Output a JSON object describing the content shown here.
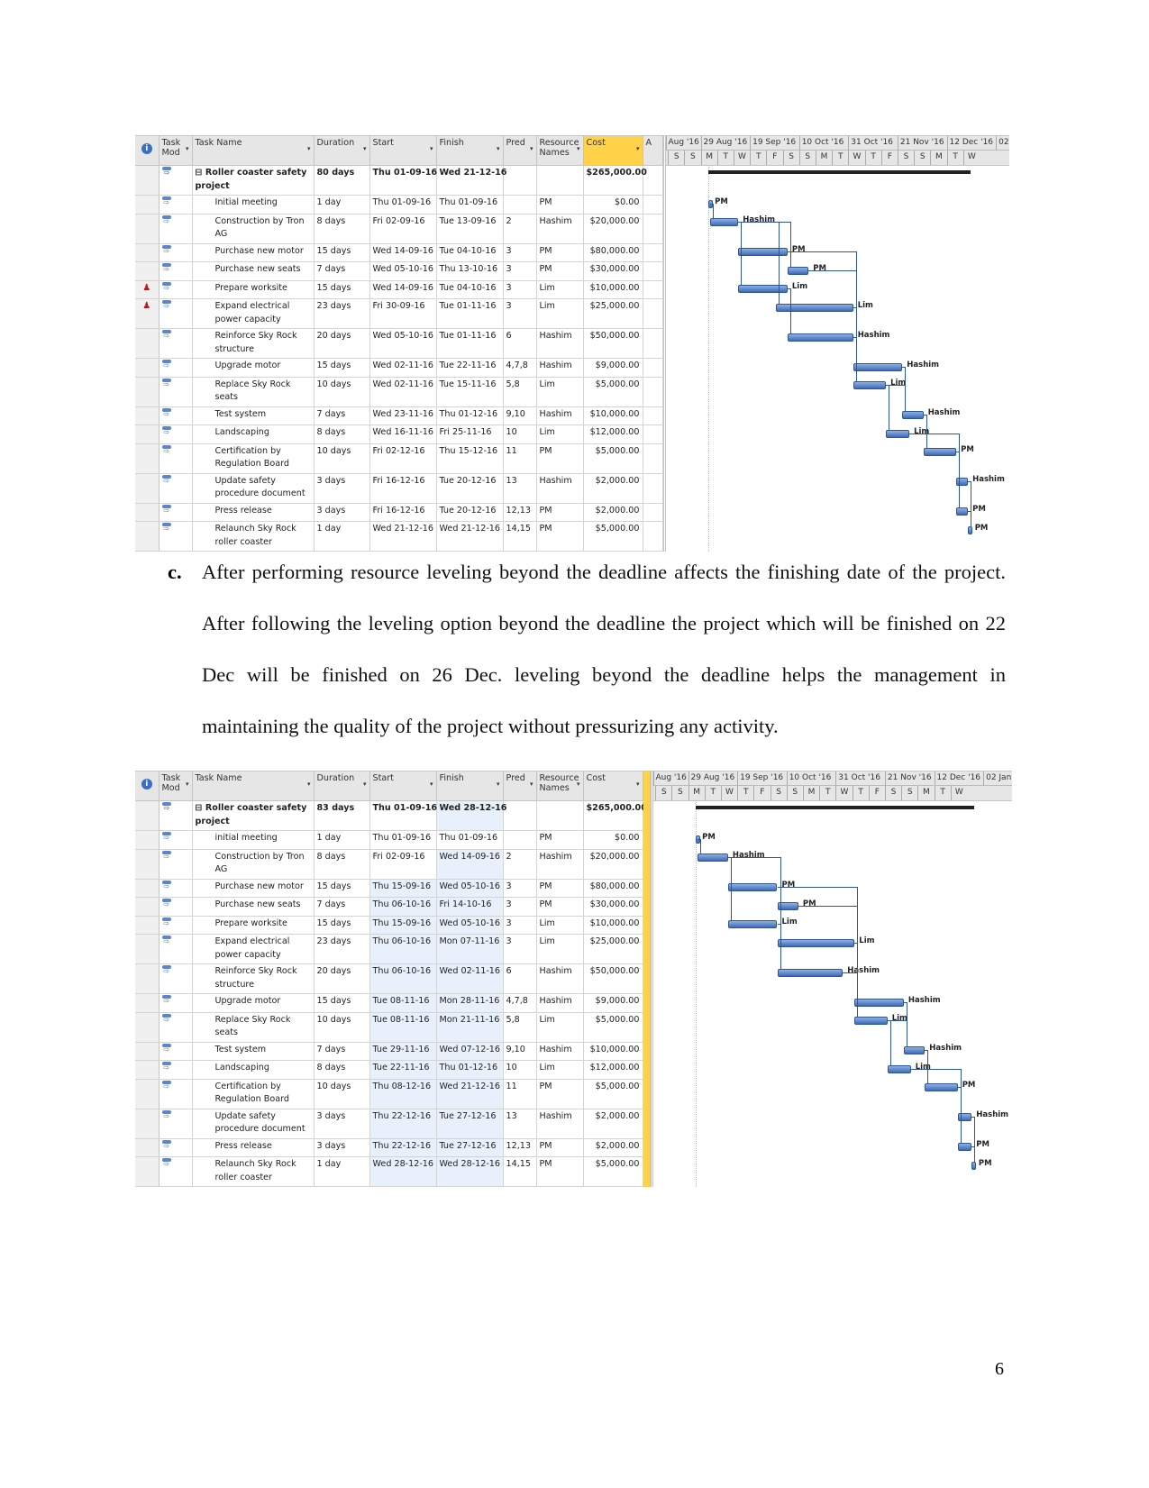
{
  "columns": {
    "indicator": "i",
    "mode": "Task Mod",
    "name": "Task Name",
    "duration": "Duration",
    "start": "Start",
    "finish": "Finish",
    "pred": "Pred",
    "resource": "Resource Names",
    "cost": "Cost",
    "add": "A"
  },
  "before": {
    "timescale": {
      "major": [
        "Aug '16",
        "29 Aug '16",
        "19 Sep '16",
        "10 Oct '16",
        "31 Oct '16",
        "21 Nov '16",
        "12 Dec '16",
        "02"
      ],
      "minor": [
        "S",
        "S",
        "M",
        "T",
        "W",
        "T",
        "F",
        "S",
        "S",
        "M",
        "T",
        "W",
        "T",
        "F",
        "S",
        "S",
        "M",
        "T",
        "W"
      ]
    },
    "rows": [
      {
        "name": "Roller coaster safety project",
        "duration": "80 days",
        "start": "Thu 01-09-16",
        "finish": "Wed 21-12-16",
        "pred": "",
        "resource": "",
        "cost": "$265,000.00",
        "summary": true,
        "lines": 2
      },
      {
        "name": "Initial meeting",
        "duration": "1 day",
        "start": "Thu 01-09-16",
        "finish": "Thu 01-09-16",
        "pred": "",
        "resource": "PM",
        "cost": "$0.00",
        "lines": 1
      },
      {
        "name": "Construction by Tron AG",
        "duration": "8 days",
        "start": "Fri 02-09-16",
        "finish": "Tue 13-09-16",
        "pred": "2",
        "resource": "Hashim",
        "cost": "$20,000.00",
        "lines": 2
      },
      {
        "name": "Purchase new motor",
        "duration": "15 days",
        "start": "Wed 14-09-16",
        "finish": "Tue 04-10-16",
        "pred": "3",
        "resource": "PM",
        "cost": "$80,000.00",
        "lines": 1
      },
      {
        "name": "Purchase new seats",
        "duration": "7 days",
        "start": "Wed 05-10-16",
        "finish": "Thu 13-10-16",
        "pred": "3",
        "resource": "PM",
        "cost": "$30,000.00",
        "lines": 1
      },
      {
        "name": "Prepare worksite",
        "duration": "15 days",
        "start": "Wed 14-09-16",
        "finish": "Tue 04-10-16",
        "pred": "3",
        "resource": "Lim",
        "cost": "$10,000.00",
        "lines": 1,
        "overallocated": true
      },
      {
        "name": "Expand electrical power capacity",
        "duration": "23 days",
        "start": "Fri 30-09-16",
        "finish": "Tue 01-11-16",
        "pred": "3",
        "resource": "Lim",
        "cost": "$25,000.00",
        "lines": 2,
        "overallocated": true
      },
      {
        "name": "Reinforce Sky Rock structure",
        "duration": "20 days",
        "start": "Wed 05-10-16",
        "finish": "Tue 01-11-16",
        "pred": "6",
        "resource": "Hashim",
        "cost": "$50,000.00",
        "lines": 2
      },
      {
        "name": "Upgrade motor",
        "duration": "15 days",
        "start": "Wed 02-11-16",
        "finish": "Tue 22-11-16",
        "pred": "4,7,8",
        "resource": "Hashim",
        "cost": "$9,000.00",
        "lines": 1
      },
      {
        "name": "Replace Sky Rock seats",
        "duration": "10 days",
        "start": "Wed 02-11-16",
        "finish": "Tue 15-11-16",
        "pred": "5,8",
        "resource": "Lim",
        "cost": "$5,000.00",
        "lines": 2
      },
      {
        "name": "Test system",
        "duration": "7 days",
        "start": "Wed 23-11-16",
        "finish": "Thu 01-12-16",
        "pred": "9,10",
        "resource": "Hashim",
        "cost": "$10,000.00",
        "lines": 1
      },
      {
        "name": "Landscaping",
        "duration": "8 days",
        "start": "Wed 16-11-16",
        "finish": "Fri 25-11-16",
        "pred": "10",
        "resource": "Lim",
        "cost": "$12,000.00",
        "lines": 1
      },
      {
        "name": "Certification by Regulation Board",
        "duration": "10 days",
        "start": "Fri 02-12-16",
        "finish": "Thu 15-12-16",
        "pred": "11",
        "resource": "PM",
        "cost": "$5,000.00",
        "lines": 2
      },
      {
        "name": "Update safety procedure document",
        "duration": "3 days",
        "start": "Fri 16-12-16",
        "finish": "Tue 20-12-16",
        "pred": "13",
        "resource": "Hashim",
        "cost": "$2,000.00",
        "lines": 2
      },
      {
        "name": "Press release",
        "duration": "3 days",
        "start": "Fri 16-12-16",
        "finish": "Tue 20-12-16",
        "pred": "12,13",
        "resource": "PM",
        "cost": "$2,000.00",
        "lines": 1
      },
      {
        "name": "Relaunch Sky Rock roller coaster",
        "duration": "1 day",
        "start": "Wed 21-12-16",
        "finish": "Wed 21-12-16",
        "pred": "14,15",
        "resource": "PM",
        "cost": "$5,000.00",
        "lines": 2
      }
    ]
  },
  "paragraph": {
    "label": "c.",
    "text": "After performing resource leveling beyond the deadline affects the finishing date of the project. After following the leveling option beyond the deadline the project which will be finished on 22 Dec will be finished on 26 Dec. leveling beyond the deadline helps the management in maintaining the quality of the project without pressurizing any activity."
  },
  "after": {
    "timescale": {
      "major": [
        "Aug '16",
        "29 Aug '16",
        "19 Sep '16",
        "10 Oct '16",
        "31 Oct '16",
        "21 Nov '16",
        "12 Dec '16",
        "02 Jan"
      ],
      "minor": [
        "S",
        "S",
        "M",
        "T",
        "W",
        "T",
        "F",
        "S",
        "S",
        "M",
        "T",
        "W",
        "T",
        "F",
        "S",
        "S",
        "M",
        "T",
        "W"
      ]
    },
    "rows": [
      {
        "name": "Roller coaster safety project",
        "duration": "83 days",
        "start": "Thu 01-09-16",
        "finish": "Wed 28-12-16",
        "pred": "",
        "resource": "",
        "cost": "$265,000.00",
        "summary": true,
        "lines": 2
      },
      {
        "name": "initial meeting",
        "duration": "1 day",
        "start": "Thu 01-09-16",
        "finish": "Thu 01-09-16",
        "pred": "",
        "resource": "PM",
        "cost": "$0.00",
        "lines": 1
      },
      {
        "name": "Construction by Tron AG",
        "duration": "8 days",
        "start": "Fri 02-09-16",
        "finish": "Wed 14-09-16",
        "pred": "2",
        "resource": "Hashim",
        "cost": "$20,000.00",
        "lines": 2
      },
      {
        "name": "Purchase new motor",
        "duration": "15 days",
        "start": "Thu 15-09-16",
        "finish": "Wed 05-10-16",
        "pred": "3",
        "resource": "PM",
        "cost": "$80,000.00",
        "lines": 1
      },
      {
        "name": "Purchase new seats",
        "duration": "7 days",
        "start": "Thu 06-10-16",
        "finish": "Fri 14-10-16",
        "pred": "3",
        "resource": "PM",
        "cost": "$30,000.00",
        "lines": 1
      },
      {
        "name": "Prepare worksite",
        "duration": "15 days",
        "start": "Thu 15-09-16",
        "finish": "Wed 05-10-16",
        "pred": "3",
        "resource": "Lim",
        "cost": "$10,000.00",
        "lines": 1
      },
      {
        "name": "Expand electrical power capacity",
        "duration": "23 days",
        "start": "Thu 06-10-16",
        "finish": "Mon 07-11-16",
        "pred": "3",
        "resource": "Lim",
        "cost": "$25,000.00",
        "lines": 2
      },
      {
        "name": "Reinforce Sky Rock structure",
        "duration": "20 days",
        "start": "Thu 06-10-16",
        "finish": "Wed 02-11-16",
        "pred": "6",
        "resource": "Hashim",
        "cost": "$50,000.00",
        "lines": 2
      },
      {
        "name": "Upgrade motor",
        "duration": "15 days",
        "start": "Tue 08-11-16",
        "finish": "Mon 28-11-16",
        "pred": "4,7,8",
        "resource": "Hashim",
        "cost": "$9,000.00",
        "lines": 1
      },
      {
        "name": "Replace Sky Rock seats",
        "duration": "10 days",
        "start": "Tue 08-11-16",
        "finish": "Mon 21-11-16",
        "pred": "5,8",
        "resource": "Lim",
        "cost": "$5,000.00",
        "lines": 2
      },
      {
        "name": "Test system",
        "duration": "7 days",
        "start": "Tue 29-11-16",
        "finish": "Wed 07-12-16",
        "pred": "9,10",
        "resource": "Hashim",
        "cost": "$10,000.00",
        "lines": 1
      },
      {
        "name": "Landscaping",
        "duration": "8 days",
        "start": "Tue 22-11-16",
        "finish": "Thu 01-12-16",
        "pred": "10",
        "resource": "Lim",
        "cost": "$12,000.00",
        "lines": 1
      },
      {
        "name": "Certification by Regulation Board",
        "duration": "10 days",
        "start": "Thu 08-12-16",
        "finish": "Wed 21-12-16",
        "pred": "11",
        "resource": "PM",
        "cost": "$5,000.00",
        "lines": 2
      },
      {
        "name": "Update safety procedure document",
        "duration": "3 days",
        "start": "Thu 22-12-16",
        "finish": "Tue 27-12-16",
        "pred": "13",
        "resource": "Hashim",
        "cost": "$2,000.00",
        "lines": 2
      },
      {
        "name": "Press release",
        "duration": "3 days",
        "start": "Thu 22-12-16",
        "finish": "Tue 27-12-16",
        "pred": "12,13",
        "resource": "PM",
        "cost": "$2,000.00",
        "lines": 1
      },
      {
        "name": "Relaunch Sky Rock roller coaster",
        "duration": "1 day",
        "start": "Wed 28-12-16",
        "finish": "Wed 28-12-16",
        "pred": "14,15",
        "resource": "PM",
        "cost": "$5,000.00",
        "lines": 2
      }
    ]
  },
  "page_number": "6",
  "colors": {
    "bar": "#3d6bb8",
    "cost_header": "#ffd24a",
    "changed_cell": "#e8f1fb",
    "overallocated": "#d01010"
  }
}
